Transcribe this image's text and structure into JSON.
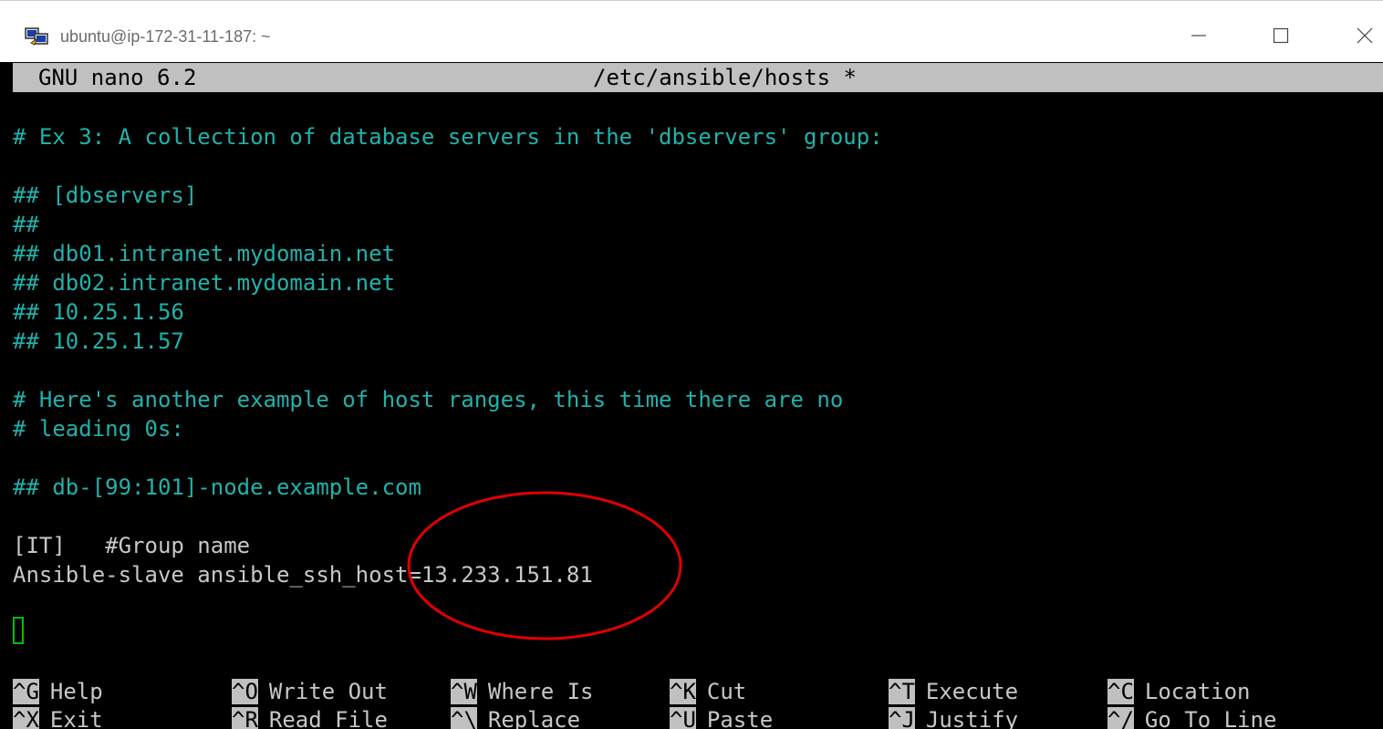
{
  "window": {
    "title": "ubuntu@ip-172-31-11-187: ~",
    "minimize_icon": "minimize-icon",
    "maximize_icon": "maximize-icon",
    "close_icon": "close-icon"
  },
  "nano": {
    "version": "GNU nano 6.2",
    "filename": "/etc/ansible/hosts *"
  },
  "lines": [
    {
      "text": "# Ex 3: A collection of database servers in the 'dbservers' group:",
      "style": "comment"
    },
    {
      "text": "## [dbservers]",
      "style": "comment"
    },
    {
      "text": "##",
      "style": "comment"
    },
    {
      "text": "## db01.intranet.mydomain.net",
      "style": "comment"
    },
    {
      "text": "## db02.intranet.mydomain.net",
      "style": "comment"
    },
    {
      "text": "## 10.25.1.56",
      "style": "comment"
    },
    {
      "text": "## 10.25.1.57",
      "style": "comment"
    },
    {
      "text": "# Here's another example of host ranges, this time there are no",
      "style": "comment"
    },
    {
      "text": "# leading 0s:",
      "style": "comment"
    },
    {
      "text": "## db-[99:101]-node.example.com",
      "style": "comment"
    },
    {
      "text": "[IT]   #Group name",
      "style": "plain"
    },
    {
      "text": "Ansible-slave ansible_ssh_host=13.233.151.81",
      "style": "plain"
    }
  ],
  "shortcuts": [
    {
      "key": "^G",
      "label": "Help"
    },
    {
      "key": "^O",
      "label": "Write Out"
    },
    {
      "key": "^W",
      "label": "Where Is"
    },
    {
      "key": "^K",
      "label": "Cut"
    },
    {
      "key": "^T",
      "label": "Execute"
    },
    {
      "key": "^C",
      "label": "Location"
    },
    {
      "key": "^X",
      "label": "Exit"
    },
    {
      "key": "^R",
      "label": "Read File"
    },
    {
      "key": "^\\",
      "label": "Replace"
    },
    {
      "key": "^U",
      "label": "Paste"
    },
    {
      "key": "^J",
      "label": "Justify"
    },
    {
      "key": "^/",
      "label": "Go To Line"
    }
  ],
  "colors": {
    "comment": "#20b2aa",
    "plain": "#c8c8c8",
    "header_bg": "#c0c0c0",
    "annotation": "#e00000",
    "cursor": "#00c000"
  }
}
